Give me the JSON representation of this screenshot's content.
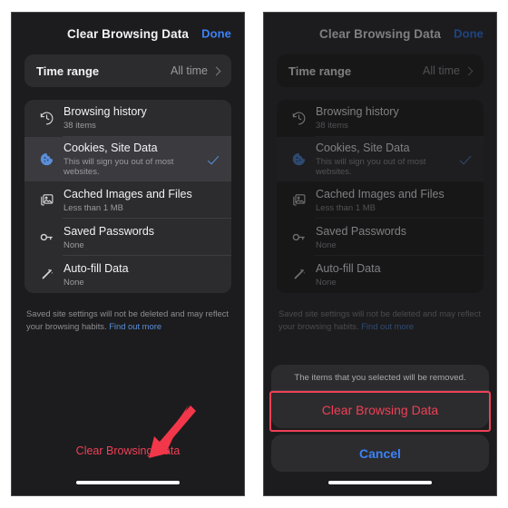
{
  "panels": {
    "left": {
      "navbar": {
        "title": "Clear Browsing Data",
        "done_label": "Done"
      },
      "time_range": {
        "label": "Time range",
        "value": "All time",
        "chevron_icon": "chevron-right-icon"
      },
      "options": [
        {
          "icon": "history-clock-icon",
          "title": "Browsing history",
          "subtitle": "38 items",
          "selected": false
        },
        {
          "icon": "cookie-icon",
          "title": "Cookies, Site Data",
          "subtitle": "This will sign you out of most websites.",
          "selected": true
        },
        {
          "icon": "images-stack-icon",
          "title": "Cached Images and Files",
          "subtitle": "Less than 1 MB",
          "selected": false
        },
        {
          "icon": "key-icon",
          "title": "Saved Passwords",
          "subtitle": "None",
          "selected": false
        },
        {
          "icon": "magic-wand-icon",
          "title": "Auto-fill Data",
          "subtitle": "None",
          "selected": false
        }
      ],
      "footnote": {
        "text": "Saved site settings will not be deleted and may reflect your browsing habits. ",
        "link_label": "Find out more"
      },
      "bottom_action_label": "Clear Browsing Data",
      "annotation": {
        "type": "red-arrow",
        "color": "#ef4056",
        "points_to": "Clear Browsing Data"
      }
    },
    "right": {
      "navbar": {
        "title": "Clear Browsing Data",
        "done_label": "Done"
      },
      "time_range": {
        "label": "Time range",
        "value": "All time",
        "chevron_icon": "chevron-right-icon"
      },
      "options": [
        {
          "icon": "history-clock-icon",
          "title": "Browsing history",
          "subtitle": "38 items",
          "selected": false
        },
        {
          "icon": "cookie-icon",
          "title": "Cookies, Site Data",
          "subtitle": "This will sign you out of most websites.",
          "selected": true
        },
        {
          "icon": "images-stack-icon",
          "title": "Cached Images and Files",
          "subtitle": "Less than 1 MB",
          "selected": false
        },
        {
          "icon": "key-icon",
          "title": "Saved Passwords",
          "subtitle": "None",
          "selected": false
        },
        {
          "icon": "magic-wand-icon",
          "title": "Auto-fill Data",
          "subtitle": "None",
          "selected": false
        }
      ],
      "footnote": {
        "text": "Saved site settings will not be deleted and may reflect your browsing habits. ",
        "link_label": "Find out more"
      },
      "action_sheet": {
        "message": "The items that you selected will be removed.",
        "destructive_label": "Clear Browsing Data",
        "cancel_label": "Cancel",
        "highlight_color": "#ef4056"
      }
    }
  },
  "colors": {
    "screen_background": "#1c1c1e",
    "card_background": "#2c2c2e",
    "selected_row": "#3a3a3f",
    "accent_blue": "#3b82f6",
    "destructive_red": "#ef4056",
    "annotation_red": "#ef4056",
    "primary_text": "#f2f2f7",
    "secondary_text": "#9b9ba0"
  }
}
